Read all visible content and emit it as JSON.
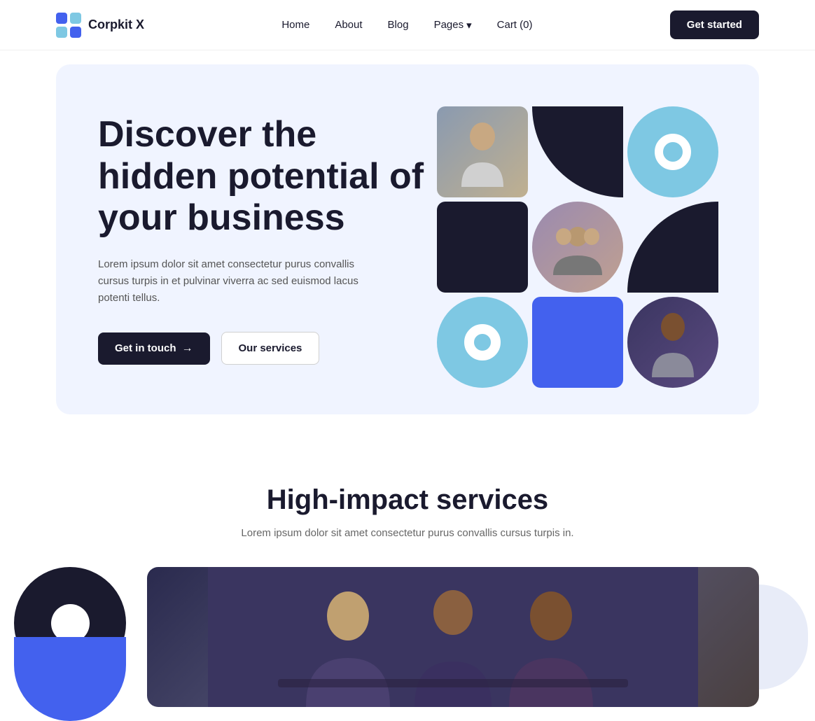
{
  "nav": {
    "logo_text": "Corpkit X",
    "links": [
      {
        "label": "Home",
        "id": "home"
      },
      {
        "label": "About",
        "id": "about"
      },
      {
        "label": "Blog",
        "id": "blog"
      }
    ],
    "pages_label": "Pages",
    "cart_label": "Cart (0)",
    "cta_label": "Get started"
  },
  "hero": {
    "title": "Discover the hidden potential of your business",
    "description": "Lorem ipsum dolor sit amet consectetur purus convallis cursus turpis in et pulvinar viverra ac sed euismod lacus potenti tellus.",
    "btn_primary": "Get in touch",
    "btn_secondary": "Our services"
  },
  "services": {
    "title": "High-impact services",
    "description": "Lorem ipsum dolor sit amet consectetur purus convallis cursus turpis in."
  }
}
